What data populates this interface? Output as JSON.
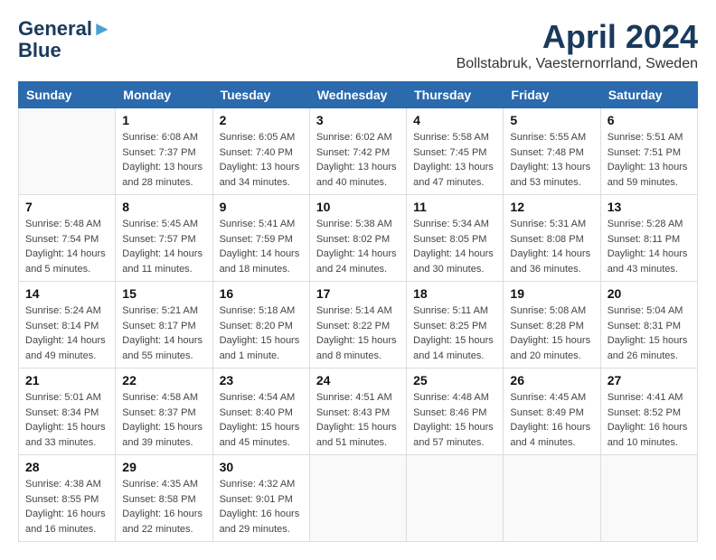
{
  "header": {
    "logo_line1": "General",
    "logo_line2": "Blue",
    "title": "April 2024",
    "subtitle": "Bollstabruk, Vaesternorrland, Sweden"
  },
  "weekdays": [
    "Sunday",
    "Monday",
    "Tuesday",
    "Wednesday",
    "Thursday",
    "Friday",
    "Saturday"
  ],
  "weeks": [
    [
      {
        "day": null
      },
      {
        "day": "1",
        "sunrise": "6:08 AM",
        "sunset": "7:37 PM",
        "daylight": "13 hours and 28 minutes."
      },
      {
        "day": "2",
        "sunrise": "6:05 AM",
        "sunset": "7:40 PM",
        "daylight": "13 hours and 34 minutes."
      },
      {
        "day": "3",
        "sunrise": "6:02 AM",
        "sunset": "7:42 PM",
        "daylight": "13 hours and 40 minutes."
      },
      {
        "day": "4",
        "sunrise": "5:58 AM",
        "sunset": "7:45 PM",
        "daylight": "13 hours and 47 minutes."
      },
      {
        "day": "5",
        "sunrise": "5:55 AM",
        "sunset": "7:48 PM",
        "daylight": "13 hours and 53 minutes."
      },
      {
        "day": "6",
        "sunrise": "5:51 AM",
        "sunset": "7:51 PM",
        "daylight": "13 hours and 59 minutes."
      }
    ],
    [
      {
        "day": "7",
        "sunrise": "5:48 AM",
        "sunset": "7:54 PM",
        "daylight": "14 hours and 5 minutes."
      },
      {
        "day": "8",
        "sunrise": "5:45 AM",
        "sunset": "7:57 PM",
        "daylight": "14 hours and 11 minutes."
      },
      {
        "day": "9",
        "sunrise": "5:41 AM",
        "sunset": "7:59 PM",
        "daylight": "14 hours and 18 minutes."
      },
      {
        "day": "10",
        "sunrise": "5:38 AM",
        "sunset": "8:02 PM",
        "daylight": "14 hours and 24 minutes."
      },
      {
        "day": "11",
        "sunrise": "5:34 AM",
        "sunset": "8:05 PM",
        "daylight": "14 hours and 30 minutes."
      },
      {
        "day": "12",
        "sunrise": "5:31 AM",
        "sunset": "8:08 PM",
        "daylight": "14 hours and 36 minutes."
      },
      {
        "day": "13",
        "sunrise": "5:28 AM",
        "sunset": "8:11 PM",
        "daylight": "14 hours and 43 minutes."
      }
    ],
    [
      {
        "day": "14",
        "sunrise": "5:24 AM",
        "sunset": "8:14 PM",
        "daylight": "14 hours and 49 minutes."
      },
      {
        "day": "15",
        "sunrise": "5:21 AM",
        "sunset": "8:17 PM",
        "daylight": "14 hours and 55 minutes."
      },
      {
        "day": "16",
        "sunrise": "5:18 AM",
        "sunset": "8:20 PM",
        "daylight": "15 hours and 1 minute."
      },
      {
        "day": "17",
        "sunrise": "5:14 AM",
        "sunset": "8:22 PM",
        "daylight": "15 hours and 8 minutes."
      },
      {
        "day": "18",
        "sunrise": "5:11 AM",
        "sunset": "8:25 PM",
        "daylight": "15 hours and 14 minutes."
      },
      {
        "day": "19",
        "sunrise": "5:08 AM",
        "sunset": "8:28 PM",
        "daylight": "15 hours and 20 minutes."
      },
      {
        "day": "20",
        "sunrise": "5:04 AM",
        "sunset": "8:31 PM",
        "daylight": "15 hours and 26 minutes."
      }
    ],
    [
      {
        "day": "21",
        "sunrise": "5:01 AM",
        "sunset": "8:34 PM",
        "daylight": "15 hours and 33 minutes."
      },
      {
        "day": "22",
        "sunrise": "4:58 AM",
        "sunset": "8:37 PM",
        "daylight": "15 hours and 39 minutes."
      },
      {
        "day": "23",
        "sunrise": "4:54 AM",
        "sunset": "8:40 PM",
        "daylight": "15 hours and 45 minutes."
      },
      {
        "day": "24",
        "sunrise": "4:51 AM",
        "sunset": "8:43 PM",
        "daylight": "15 hours and 51 minutes."
      },
      {
        "day": "25",
        "sunrise": "4:48 AM",
        "sunset": "8:46 PM",
        "daylight": "15 hours and 57 minutes."
      },
      {
        "day": "26",
        "sunrise": "4:45 AM",
        "sunset": "8:49 PM",
        "daylight": "16 hours and 4 minutes."
      },
      {
        "day": "27",
        "sunrise": "4:41 AM",
        "sunset": "8:52 PM",
        "daylight": "16 hours and 10 minutes."
      }
    ],
    [
      {
        "day": "28",
        "sunrise": "4:38 AM",
        "sunset": "8:55 PM",
        "daylight": "16 hours and 16 minutes."
      },
      {
        "day": "29",
        "sunrise": "4:35 AM",
        "sunset": "8:58 PM",
        "daylight": "16 hours and 22 minutes."
      },
      {
        "day": "30",
        "sunrise": "4:32 AM",
        "sunset": "9:01 PM",
        "daylight": "16 hours and 29 minutes."
      },
      {
        "day": null
      },
      {
        "day": null
      },
      {
        "day": null
      },
      {
        "day": null
      }
    ]
  ],
  "labels": {
    "sunrise": "Sunrise:",
    "sunset": "Sunset:",
    "daylight": "Daylight hours"
  }
}
